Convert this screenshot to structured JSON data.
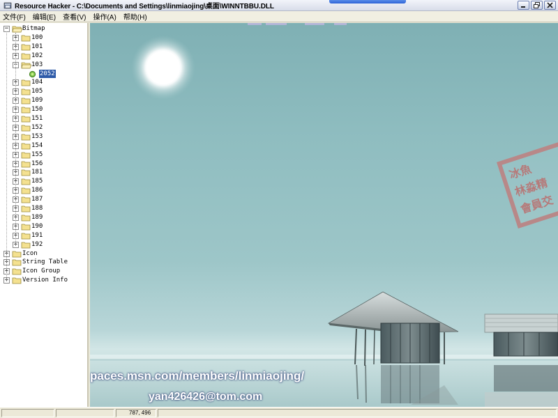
{
  "window": {
    "title": "Resource Hacker  -  C:\\Documents and Settings\\linmiaojing\\桌面\\WINNTBBU.DLL",
    "accent_color": "#2c62d6"
  },
  "menu": [
    {
      "label": "文件(F)"
    },
    {
      "label": "编辑(E)"
    },
    {
      "label": "查看(V)"
    },
    {
      "label": "操作(A)"
    },
    {
      "label": "帮助(H)"
    }
  ],
  "tree": {
    "root": "Bitmap",
    "bitmap_items": [
      "100",
      "101",
      "102",
      "103"
    ],
    "resource_id": "2052",
    "bitmap_items_after": [
      "104",
      "105",
      "109",
      "150",
      "151",
      "152",
      "153",
      "154",
      "155",
      "156",
      "181",
      "185",
      "186",
      "187",
      "188",
      "189",
      "190",
      "191",
      "192"
    ],
    "other_roots": [
      "Icon",
      "String Table",
      "Icon Group",
      "Version Info"
    ]
  },
  "preview": {
    "watermark_url": "paces.msn.com/members/linmiaojing/",
    "watermark_email": "yan426426@tom.com",
    "stamp_lines": [
      "冰魚",
      "林淼精",
      "會員交"
    ],
    "background_color": "#8fbdc0"
  },
  "statusbar": {
    "coordinates": "787, 496"
  }
}
